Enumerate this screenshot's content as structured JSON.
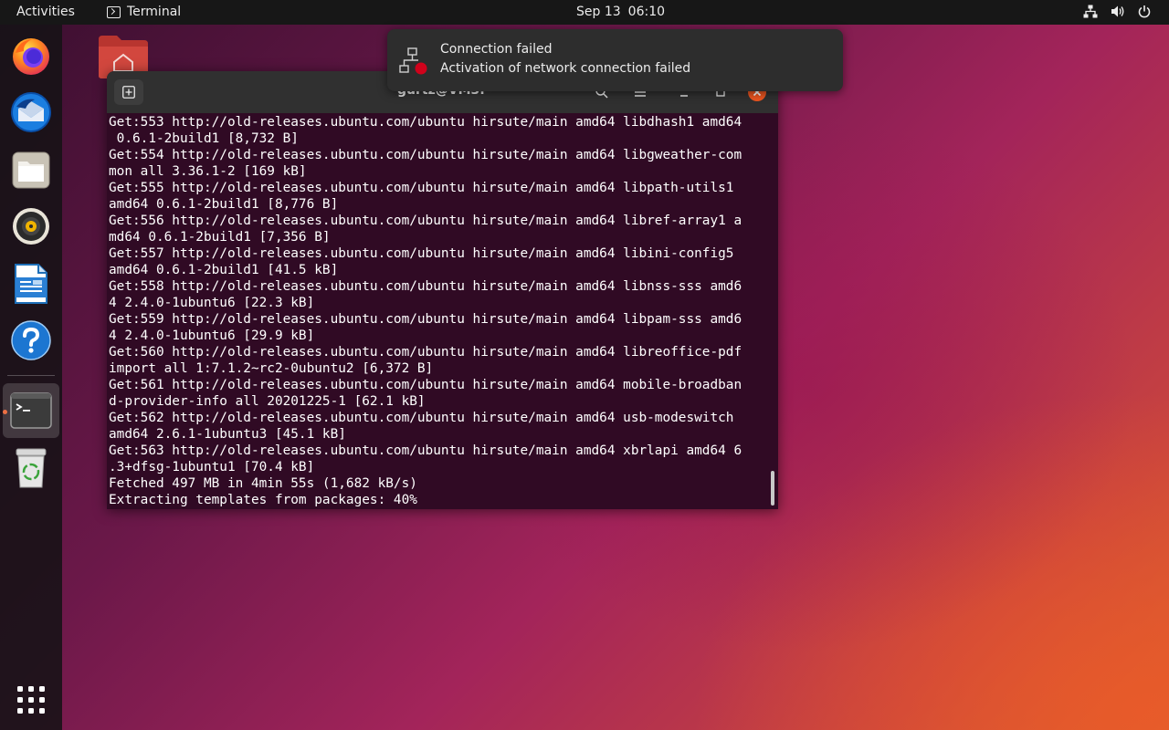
{
  "topbar": {
    "activities": "Activities",
    "app_name": "Terminal",
    "date": "Sep 13",
    "time": "06:10",
    "tray_icons": [
      "network-icon",
      "volume-icon",
      "power-icon"
    ]
  },
  "dock": {
    "items": [
      {
        "name": "firefox",
        "icon": "firefox-icon"
      },
      {
        "name": "thunderbird",
        "icon": "thunderbird-icon"
      },
      {
        "name": "files",
        "icon": "files-icon"
      },
      {
        "name": "rhythmbox",
        "icon": "rhythmbox-icon"
      },
      {
        "name": "libreoffice-writer",
        "icon": "writer-icon"
      },
      {
        "name": "help",
        "icon": "help-icon"
      },
      {
        "name": "terminal",
        "icon": "terminal-icon",
        "running": true
      },
      {
        "name": "trash",
        "icon": "trash-icon"
      }
    ],
    "show_apps_icon": "app-grid-icon"
  },
  "notification": {
    "title": "Connection failed",
    "body": "Activation of network connection failed",
    "icon": "network-error-icon"
  },
  "terminal": {
    "title": "gurtz@VM3: ~",
    "lines": [
      "Get:553 http://old-releases.ubuntu.com/ubuntu hirsute/main amd64 libdhash1 amd64",
      " 0.6.1-2build1 [8,732 B]",
      "Get:554 http://old-releases.ubuntu.com/ubuntu hirsute/main amd64 libgweather-com",
      "mon all 3.36.1-2 [169 kB]",
      "Get:555 http://old-releases.ubuntu.com/ubuntu hirsute/main amd64 libpath-utils1",
      "amd64 0.6.1-2build1 [8,776 B]",
      "Get:556 http://old-releases.ubuntu.com/ubuntu hirsute/main amd64 libref-array1 a",
      "md64 0.6.1-2build1 [7,356 B]",
      "Get:557 http://old-releases.ubuntu.com/ubuntu hirsute/main amd64 libini-config5",
      "amd64 0.6.1-2build1 [41.5 kB]",
      "Get:558 http://old-releases.ubuntu.com/ubuntu hirsute/main amd64 libnss-sss amd6",
      "4 2.4.0-1ubuntu6 [22.3 kB]",
      "Get:559 http://old-releases.ubuntu.com/ubuntu hirsute/main amd64 libpam-sss amd6",
      "4 2.4.0-1ubuntu6 [29.9 kB]",
      "Get:560 http://old-releases.ubuntu.com/ubuntu hirsute/main amd64 libreoffice-pdf",
      "import all 1:7.1.2~rc2-0ubuntu2 [6,372 B]",
      "Get:561 http://old-releases.ubuntu.com/ubuntu hirsute/main amd64 mobile-broadban",
      "d-provider-info all 20201225-1 [62.1 kB]",
      "Get:562 http://old-releases.ubuntu.com/ubuntu hirsute/main amd64 usb-modeswitch",
      "amd64 2.6.1-1ubuntu3 [45.1 kB]",
      "Get:563 http://old-releases.ubuntu.com/ubuntu hirsute/main amd64 xbrlapi amd64 6",
      ".3+dfsg-1ubuntu1 [70.4 kB]",
      "Fetched 497 MB in 4min 55s (1,682 kB/s)",
      "Extracting templates from packages: 40%"
    ]
  },
  "colors": {
    "terminal_bg": "#300a24",
    "topbar_bg": "#171717",
    "accent": "#e95420",
    "error": "#d0021b"
  }
}
